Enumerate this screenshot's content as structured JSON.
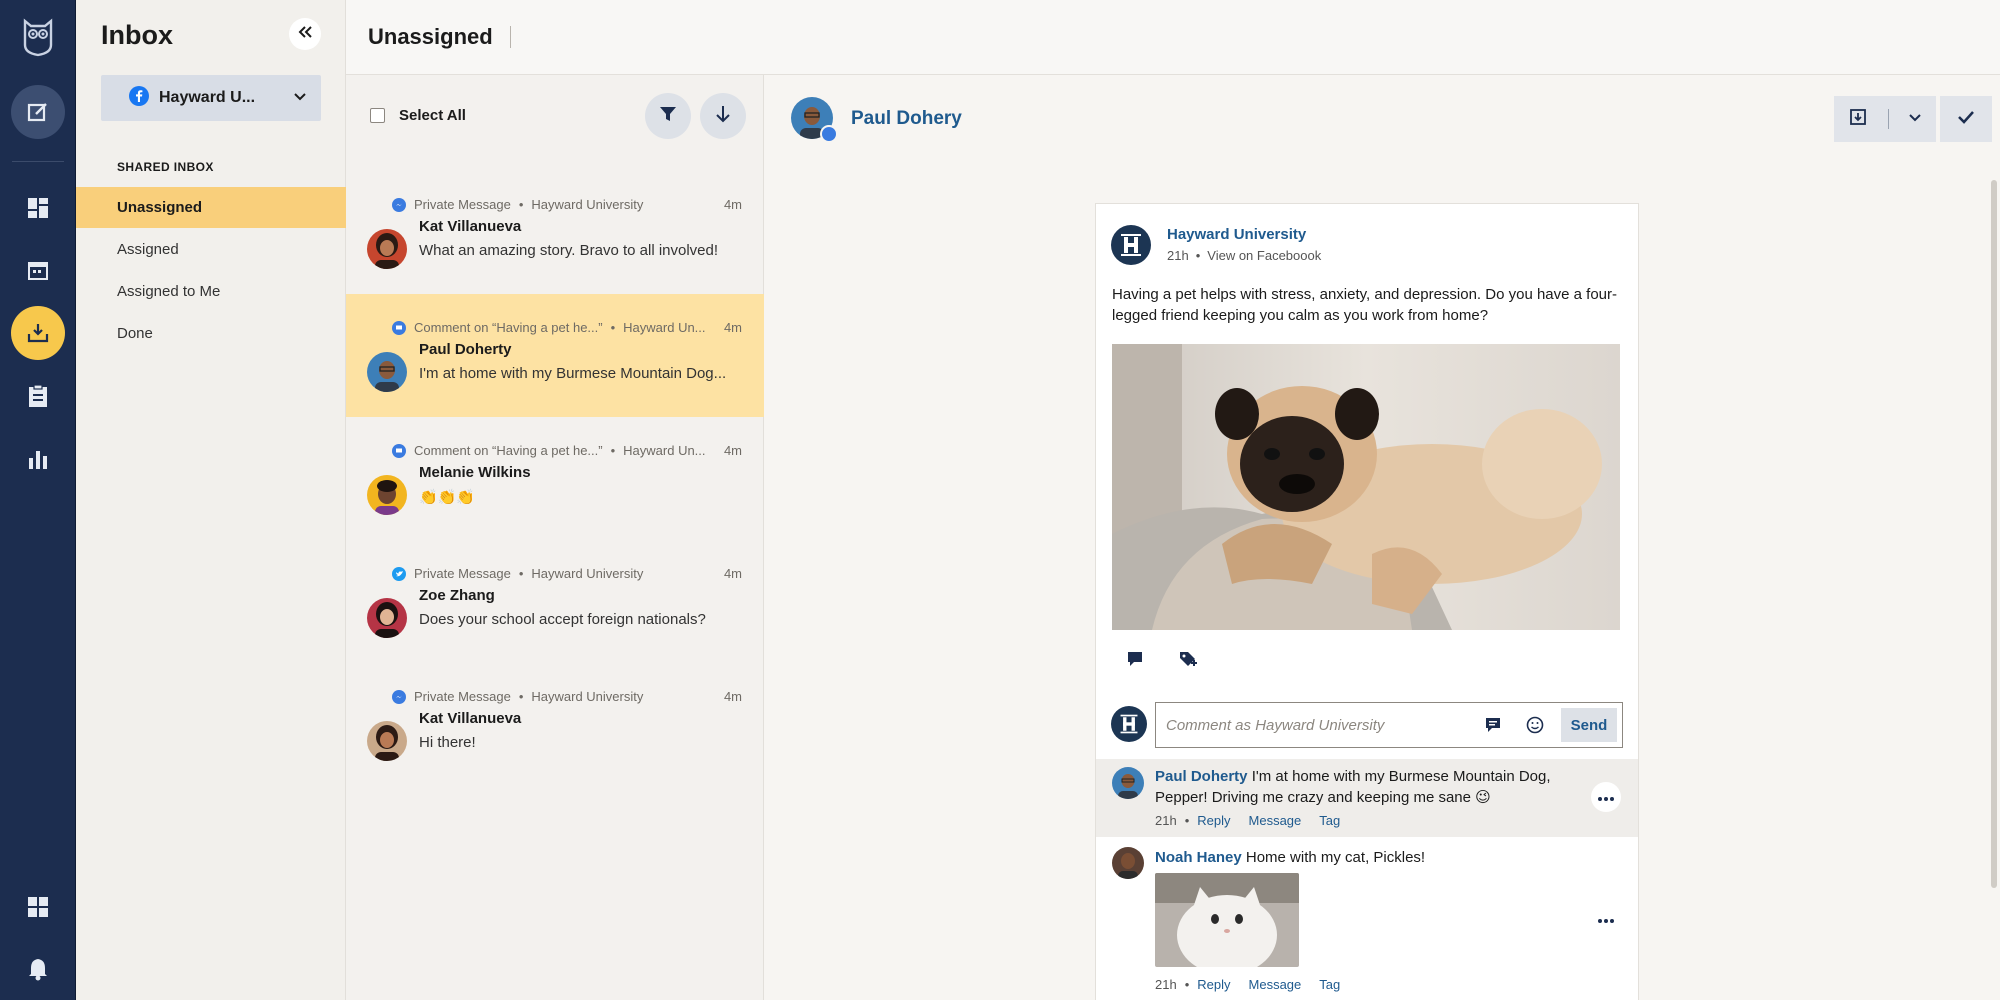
{
  "inbox": {
    "title": "Inbox",
    "account_label": "Hayward U...",
    "section_header": "SHARED INBOX",
    "nav": [
      "Unassigned",
      "Assigned",
      "Assigned to Me",
      "Done"
    ]
  },
  "topbar": {
    "title": "Unassigned"
  },
  "list": {
    "select_all": "Select All",
    "messages": [
      {
        "meta": "Private Message",
        "source": "Hayward University",
        "time": "4m",
        "name": "Kat Villanueva",
        "text": "What an amazing story. Bravo to all involved!",
        "network": "facebook"
      },
      {
        "meta": "Comment on “Having a pet he...”",
        "source": "Hayward Un...",
        "time": "4m",
        "name": "Paul Doherty",
        "text": "I'm at home with my Burmese Mountain Dog...",
        "network": "facebook"
      },
      {
        "meta": "Comment on “Having a pet he...”",
        "source": "Hayward Un...",
        "time": "4m",
        "name": "Melanie Wilkins",
        "text": "👏👏👏",
        "network": "facebook"
      },
      {
        "meta": "Private Message",
        "source": "Hayward University",
        "time": "4m",
        "name": "Zoe Zhang",
        "text": "Does your school accept foreign nationals?",
        "network": "twitter"
      },
      {
        "meta": "Private Message",
        "source": "Hayward University",
        "time": "4m",
        "name": "Kat Villanueva",
        "text": "Hi there!",
        "network": "facebook"
      }
    ]
  },
  "conversation": {
    "contact_name": "Paul Dohery",
    "post": {
      "author": "Hayward University",
      "age": "21h",
      "bullet": "•",
      "view_link": "View on Faceboook",
      "text": "Having a pet helps with stress, anxiety, and depression. Do you have a four-legged friend keeping you calm as you work from home?"
    },
    "comment_placeholder": "Comment as Hayward University",
    "send_label": "Send",
    "comments": [
      {
        "author": "Paul Doherty",
        "text": "I'm at home with my Burmese Mountain Dog, Pepper! Driving me crazy and keeping me sane 😉",
        "age": "21h",
        "reply": "Reply",
        "message": "Message",
        "tag": "Tag"
      },
      {
        "author": "Noah Haney",
        "text": "Home with my cat, Pickles!",
        "age": "21h",
        "reply": "Reply",
        "message": "Message",
        "tag": "Tag"
      }
    ]
  },
  "colors": {
    "rail": "#1c2d4f",
    "accent_yellow": "#f9cf7b",
    "link_blue": "#1f5a8e",
    "facebook_blue": "#3a7be0",
    "twitter_blue": "#1d9bf0"
  },
  "icons": [
    "owl-logo-icon",
    "compose-icon",
    "dashboard-icon",
    "calendar-icon",
    "inbox-icon",
    "clipboard-icon",
    "analytics-icon",
    "apps-icon",
    "bell-icon",
    "filter-icon",
    "sort-down-icon",
    "chevron-double-left-icon",
    "chevron-down-icon",
    "checkmark-icon",
    "assign-icon",
    "comment-icon",
    "tag-icon",
    "emoji-icon",
    "more-icon"
  ]
}
